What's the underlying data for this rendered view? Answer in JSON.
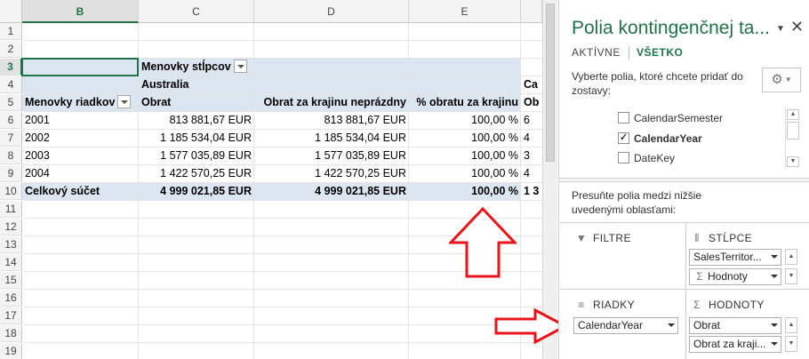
{
  "sheet": {
    "columns": [
      {
        "letter": "B",
        "selected": true
      },
      {
        "letter": "C",
        "selected": false
      },
      {
        "letter": "D",
        "selected": false
      },
      {
        "letter": "E",
        "selected": false
      }
    ],
    "row_numbers": [
      "1",
      "2",
      "3",
      "4",
      "5",
      "6",
      "7",
      "8",
      "9",
      "10",
      "11",
      "12",
      "13",
      "14",
      "15",
      "16",
      "17",
      "18",
      "19"
    ],
    "selected_row": "3",
    "column_labels_caption": "Menovky stĺpcov",
    "country": "Australia",
    "country_next_partial": "Ca",
    "row_labels_header": "Menovky riadkov",
    "value_headers": [
      "Obrat",
      "Obrat za krajinu neprázdny",
      "% obratu za krajinu"
    ],
    "next_header_partial": "Ob",
    "rows": [
      {
        "year": "2001",
        "obrat": "813 881,67 EUR",
        "obrat_nonempty": "813 881,67 EUR",
        "pct": "100,00 %",
        "next": "6"
      },
      {
        "year": "2002",
        "obrat": "1 185 534,04 EUR",
        "obrat_nonempty": "1 185 534,04 EUR",
        "pct": "100,00 %",
        "next": "4"
      },
      {
        "year": "2003",
        "obrat": "1 577 035,89 EUR",
        "obrat_nonempty": "1 577 035,89 EUR",
        "pct": "100,00 %",
        "next": "3"
      },
      {
        "year": "2004",
        "obrat": "1 422 570,25 EUR",
        "obrat_nonempty": "1 422 570,25 EUR",
        "pct": "100,00 %",
        "next": "4"
      }
    ],
    "total": {
      "label": "Celkový súčet",
      "obrat": "4 999 021,85 EUR",
      "obrat_nonempty": "4 999 021,85 EUR",
      "pct": "100,00 %",
      "next": "1 3"
    }
  },
  "pane": {
    "title": "Polia kontingenčnej ta...",
    "tabs": [
      "AKTÍVNE",
      "VŠETKO"
    ],
    "active_tab": "VŠETKO",
    "instruction": "Vyberte polia, ktoré chcete pridať do zostavy:",
    "fields": [
      {
        "name": "CalendarSemester",
        "checked": false
      },
      {
        "name": "CalendarYear",
        "checked": true
      },
      {
        "name": "DateKey",
        "checked": false
      }
    ],
    "drag_instruction": "Presuňte polia medzi nižšie uvedenými oblasťami:",
    "areas": {
      "filters": {
        "label": "FILTRE",
        "items": []
      },
      "columns": {
        "label": "STĹPCE",
        "items": [
          "SalesTerritor...",
          "Hodnoty"
        ]
      },
      "rows": {
        "label": "RIADKY",
        "items": [
          "CalendarYear"
        ]
      },
      "values": {
        "label": "HODNOTY",
        "items": [
          "Obrat",
          "Obrat za kraji..."
        ]
      }
    }
  },
  "icons": {
    "filter": "filter-icon",
    "columns": "columns-icon",
    "rows": "rows-icon",
    "sigma": "sigma-icon",
    "gear": "gear-icon",
    "close": "close-icon"
  },
  "colors": {
    "accent": "#217346",
    "pivot_band": "#dce6f1",
    "annotation_arrow": "#e8141a"
  }
}
